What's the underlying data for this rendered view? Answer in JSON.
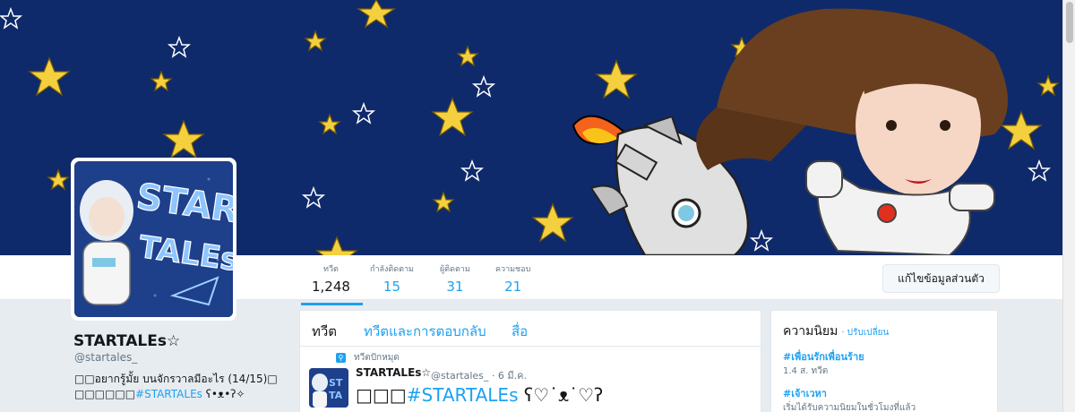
{
  "stats": [
    {
      "label": "ทวีต",
      "value": "1,248"
    },
    {
      "label": "กำลังติดตาม",
      "value": "15"
    },
    {
      "label": "ผู้ติดตาม",
      "value": "31"
    },
    {
      "label": "ความชอบ",
      "value": "21"
    }
  ],
  "edit_profile_label": "แก้ไขข้อมูลส่วนตัว",
  "profile": {
    "name": "STARTALEs☆",
    "handle": "@startales_",
    "bio_line1": "□□อยากรู้มั้ย บนจักรวาลมีอะไร (14/15)□",
    "bio_line2_prefix": "□□□□□□",
    "bio_line2_tag": "#STARTALEs",
    "bio_line2_suffix": " ʕ•ᴥ•ʔ✧"
  },
  "avatar_text": [
    "STAR",
    "TALEs"
  ],
  "timeline": {
    "tabs": [
      "ทวีต",
      "ทวีตและการตอบกลับ",
      "สื่อ"
    ],
    "pinned_label": "ทวีตปักหมุด",
    "tweet": {
      "author": "STARTALEs☆",
      "handle": "@startales_",
      "date": "· 6 มี.ค.",
      "text_prefix": "□□□",
      "text_tag": "#STARTALEs",
      "text_suffix": " ʕ♡˙ᴥ˙♡ʔ"
    }
  },
  "trends": {
    "title": "ความนิยม",
    "change_label": "· ปรับเปลี่ยน",
    "items": [
      {
        "name": "#เพื่อนรักเพื่อนร้าย",
        "meta": "1.4 ส. ทวีต"
      },
      {
        "name": "#เจ้าเวหา",
        "meta": "เริ่มได้รับความนิยมในชั่วโมงที่แล้ว"
      }
    ]
  },
  "colors": {
    "accent": "#1da1f2",
    "banner": "#0f2a6b",
    "star": "#f4d03f"
  }
}
